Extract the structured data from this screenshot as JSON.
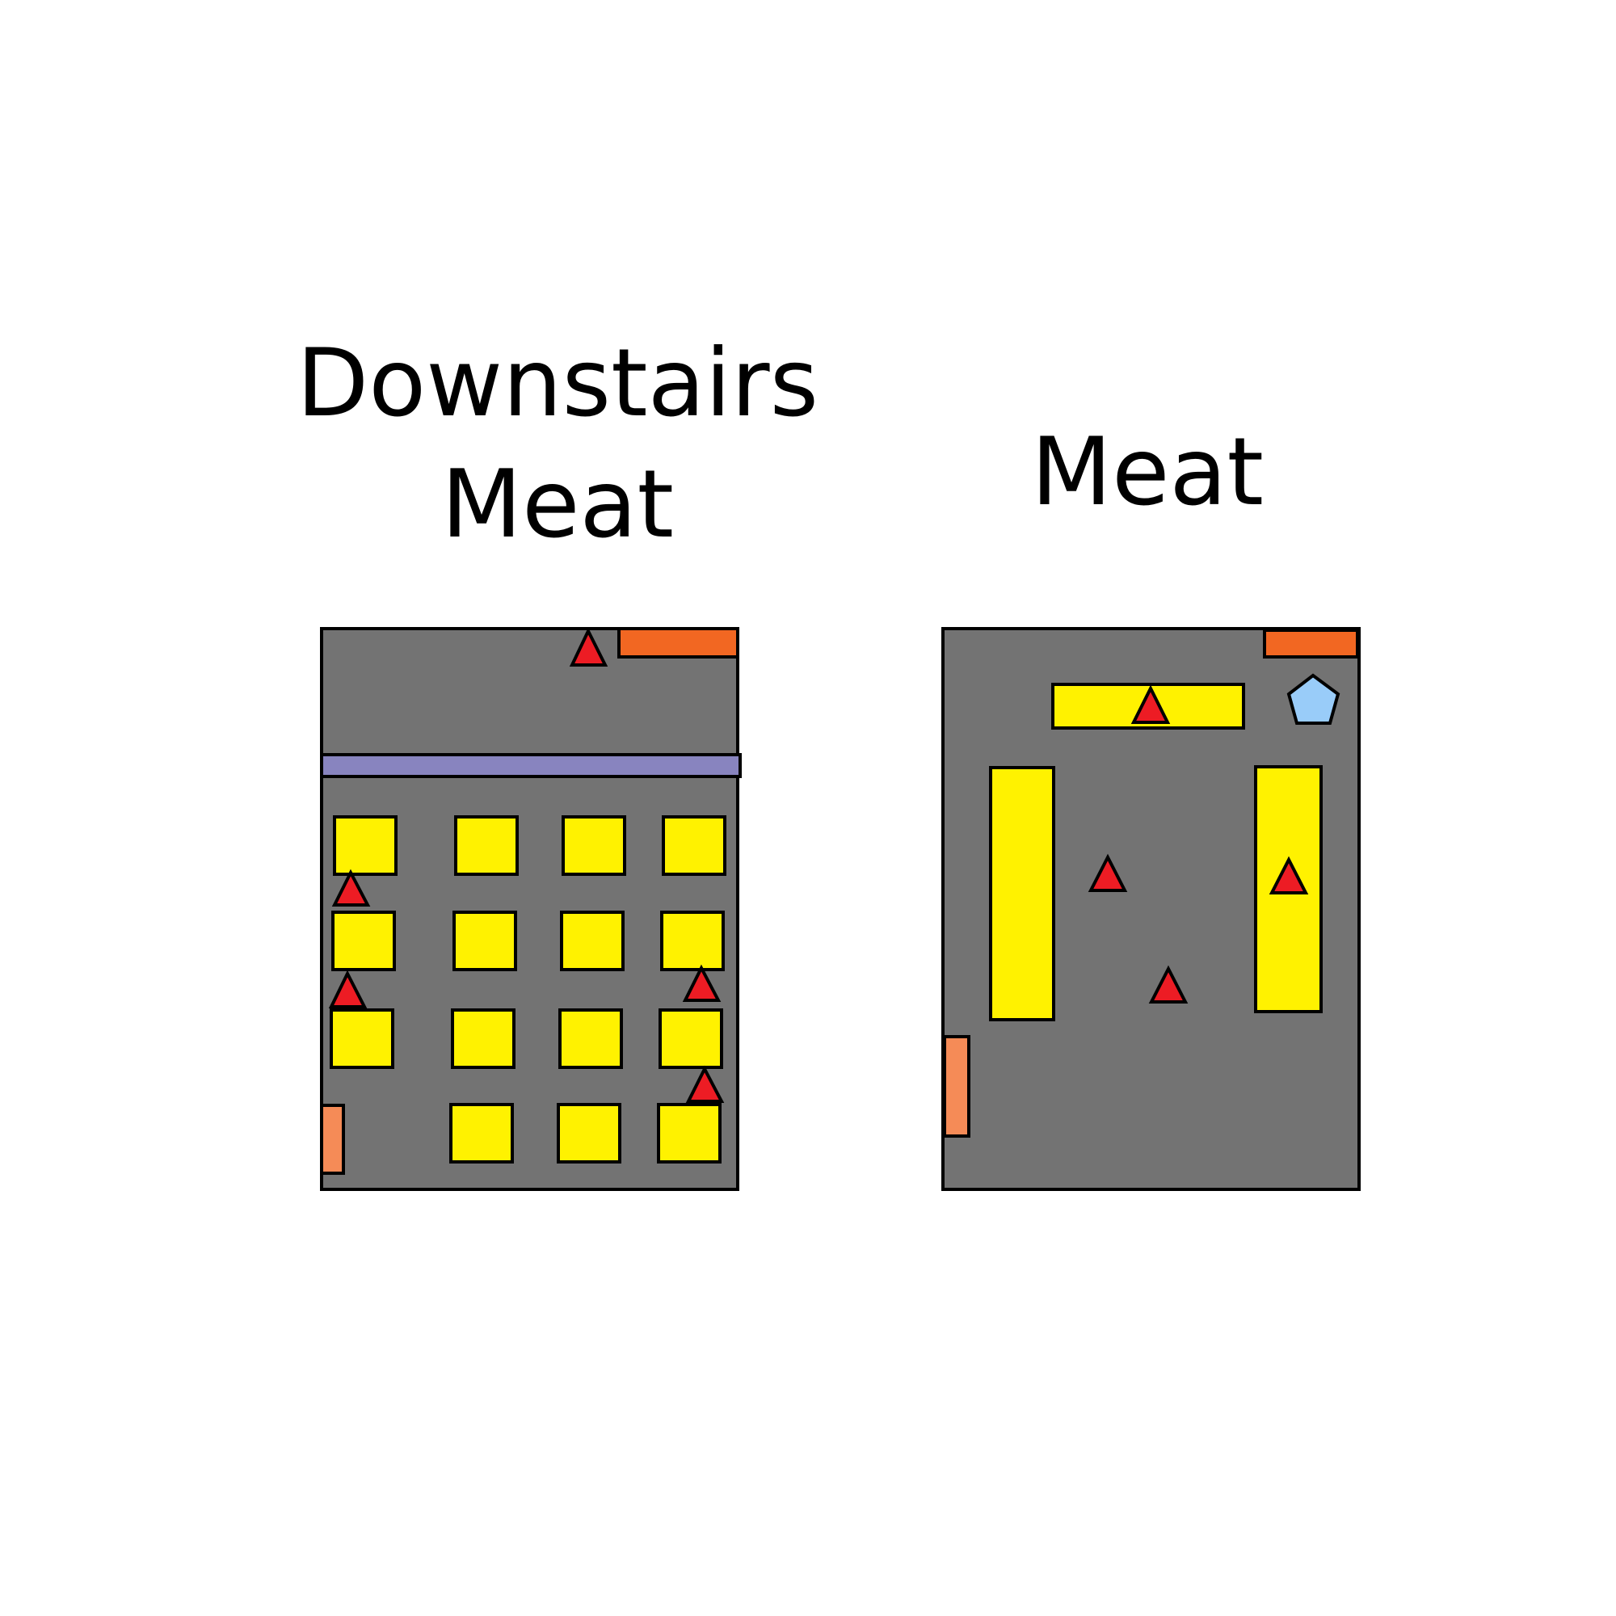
{
  "plans": [
    {
      "title_lines": [
        "Downstairs",
        "Meat"
      ],
      "colors": {
        "floor": "#737373",
        "shelf": "#fff200",
        "marker": "#ed1c24",
        "counter": "#f26722",
        "door": "#f58b57",
        "divider": "#8884bf"
      }
    },
    {
      "title_lines": [
        "Meat"
      ],
      "colors": {
        "floor": "#737373",
        "shelf": "#fff200",
        "marker": "#ed1c24",
        "counter": "#f26722",
        "door": "#f58b57",
        "pentagon": "#99ccf9"
      }
    }
  ],
  "icons": {
    "marker": "red-triangle",
    "special": "light-blue-pentagon"
  }
}
